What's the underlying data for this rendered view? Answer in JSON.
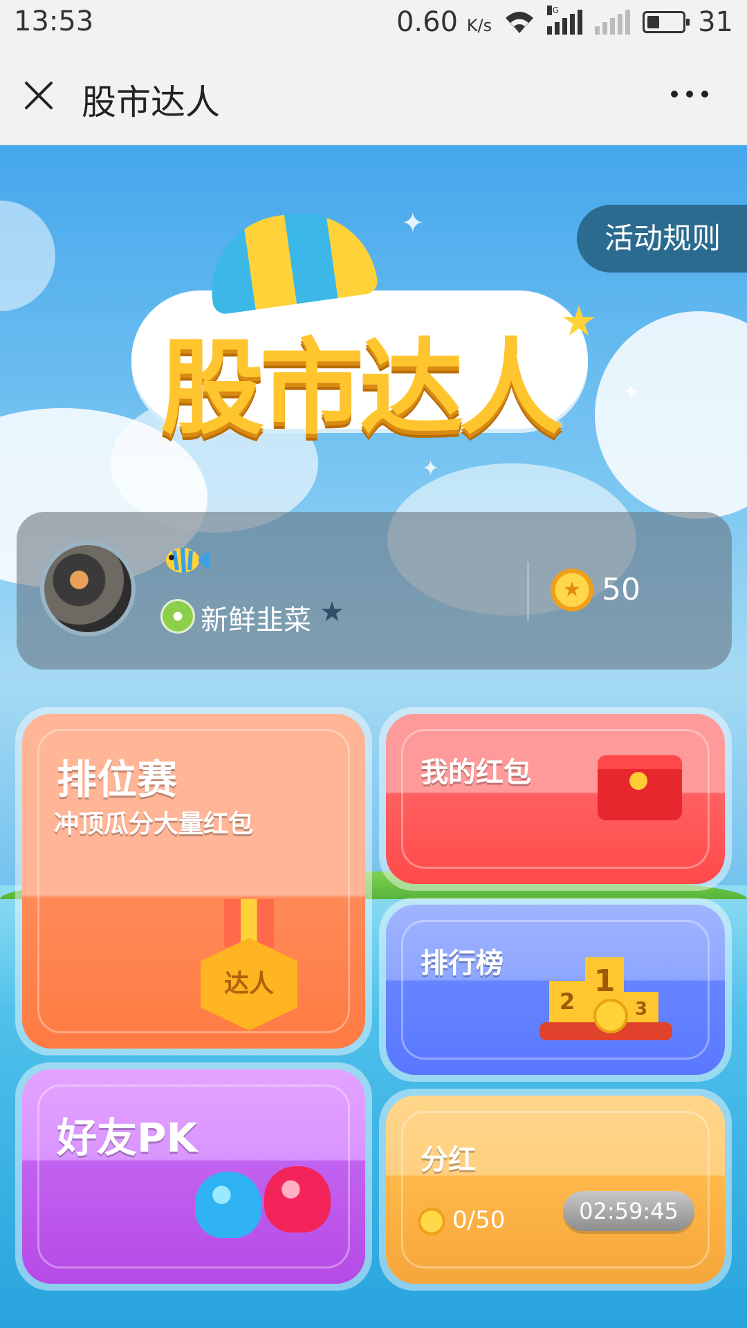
{
  "status_bar": {
    "time": "13:53",
    "net_speed": "0.60",
    "net_unit": "K/s",
    "network_type": "4G",
    "battery_level": "31"
  },
  "header": {
    "title": "股市达人"
  },
  "game": {
    "rules_label": "活动规则",
    "logo_text": "股市达人",
    "profile": {
      "nickname": "新鲜韭菜",
      "coins": "50"
    },
    "cards": {
      "rank": {
        "title": "排位赛",
        "subtitle": "冲顶瓜分大量红包",
        "medal_text": "达人"
      },
      "redpack": {
        "title": "我的红包"
      },
      "leaderboard": {
        "title": "排行榜",
        "first": "1",
        "second": "2",
        "third": "3"
      },
      "pk": {
        "title": "好友PK"
      },
      "dividend": {
        "title": "分红",
        "timer": "02:59:45",
        "progress": "0/50"
      }
    }
  },
  "colors": {
    "rank": "#ff8a58",
    "redpack": "#ff5a5a",
    "leaderboard": "#6684ff",
    "pk": "#c262f0",
    "dividend": "#ffb84a",
    "rules_button": "#2a6b8f"
  },
  "icons": [
    "close-icon",
    "more-icon",
    "wifi-icon",
    "signal-icon",
    "battery-icon",
    "fish-icon",
    "level-icon",
    "coin-icon",
    "medal-icon",
    "red-envelope-icon",
    "podium-icon",
    "boxing-glove-icon"
  ]
}
